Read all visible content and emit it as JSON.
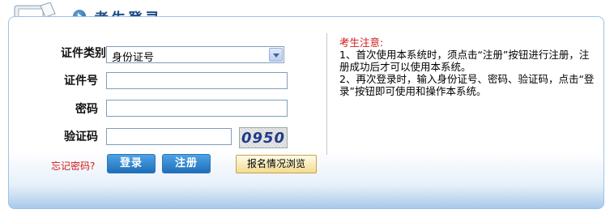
{
  "header": {
    "title": "考生登录"
  },
  "form": {
    "id_type_label": "证件类别",
    "id_type_value": "身份证号",
    "id_number_label": "证件号",
    "password_label": "密码",
    "captcha_label": "验证码",
    "captcha_image_text": "0950",
    "forgot_password": "忘记密码?",
    "login_button": "登录",
    "register_button": "注册",
    "browse_button": "报名情况浏览"
  },
  "notice": {
    "title": "考生注意:",
    "line1": "1、首次使用本系统时，须点击“注册”按钮进行注册，注册成功后才可以使用本系统。",
    "line2": "2、再次登录时，输入身份证号、密码、验证码，点击“登录”按钮即可使用和操作本系统。"
  },
  "colors": {
    "title": "#1d4f86",
    "notice_title": "#d01b1b",
    "button_blue": "#1f6fb8"
  }
}
